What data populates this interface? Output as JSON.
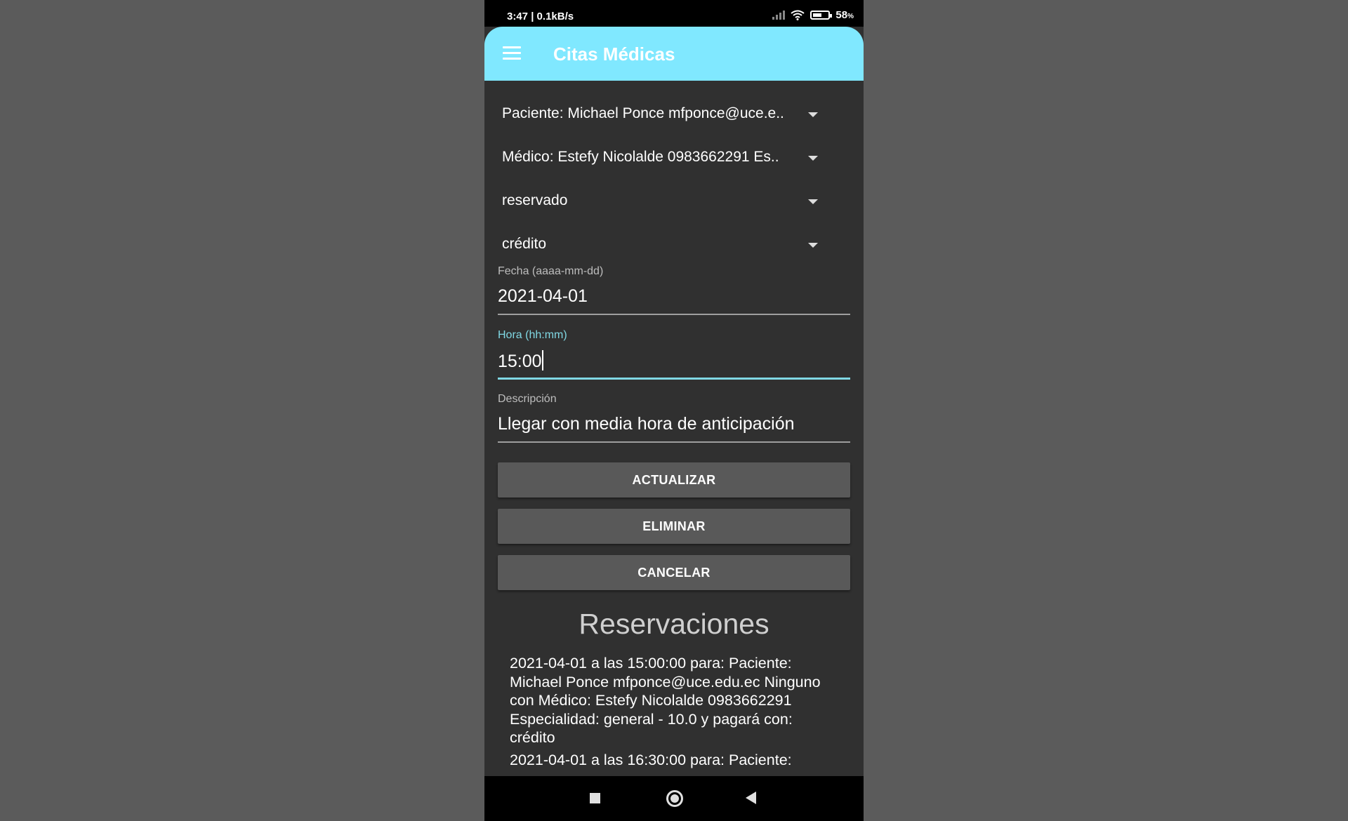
{
  "status_bar": {
    "time_speed": "3:47 | 0.1kB/s",
    "battery_percent": "58",
    "battery_unit": "%",
    "battery_level": 0.58
  },
  "app_bar": {
    "title": "Citas Médicas",
    "menu_icon": "hamburger-menu-icon"
  },
  "form": {
    "spinners": [
      {
        "text": "Paciente: Michael Ponce mfponce@uce.e.."
      },
      {
        "text": "Médico: Estefy Nicolalde 0983662291 Es.."
      },
      {
        "text": "reservado"
      },
      {
        "text": "crédito"
      }
    ],
    "fecha": {
      "label": "Fecha (aaaa-mm-dd)",
      "value": "2021-04-01"
    },
    "hora": {
      "label": "Hora (hh:mm)",
      "value": "15:00"
    },
    "descripcion": {
      "label": "Descripción",
      "value": "Llegar con media hora de anticipación"
    },
    "accent_color": "#80d8e4"
  },
  "buttons": {
    "actualizar": "ACTUALIZAR",
    "eliminar": "ELIMINAR",
    "cancelar": "CANCELAR"
  },
  "reservaciones": {
    "title": "Reservaciones",
    "items": [
      "2021-04-01 a las 15:00:00 para: Paciente: Michael Ponce mfponce@uce.edu.ec Ninguno con Médico: Estefy Nicolalde 0983662291 Especialidad: general - 10.0 y pagará con: crédito",
      "2021-04-01 a las 16:30:00 para: Paciente:"
    ]
  },
  "nav_bar": {
    "icons": [
      "recents-square-icon",
      "home-circle-icon",
      "back-triangle-icon"
    ]
  },
  "colors": {
    "app_bar": "#80e8ff",
    "background": "#303030",
    "button": "#595959"
  }
}
